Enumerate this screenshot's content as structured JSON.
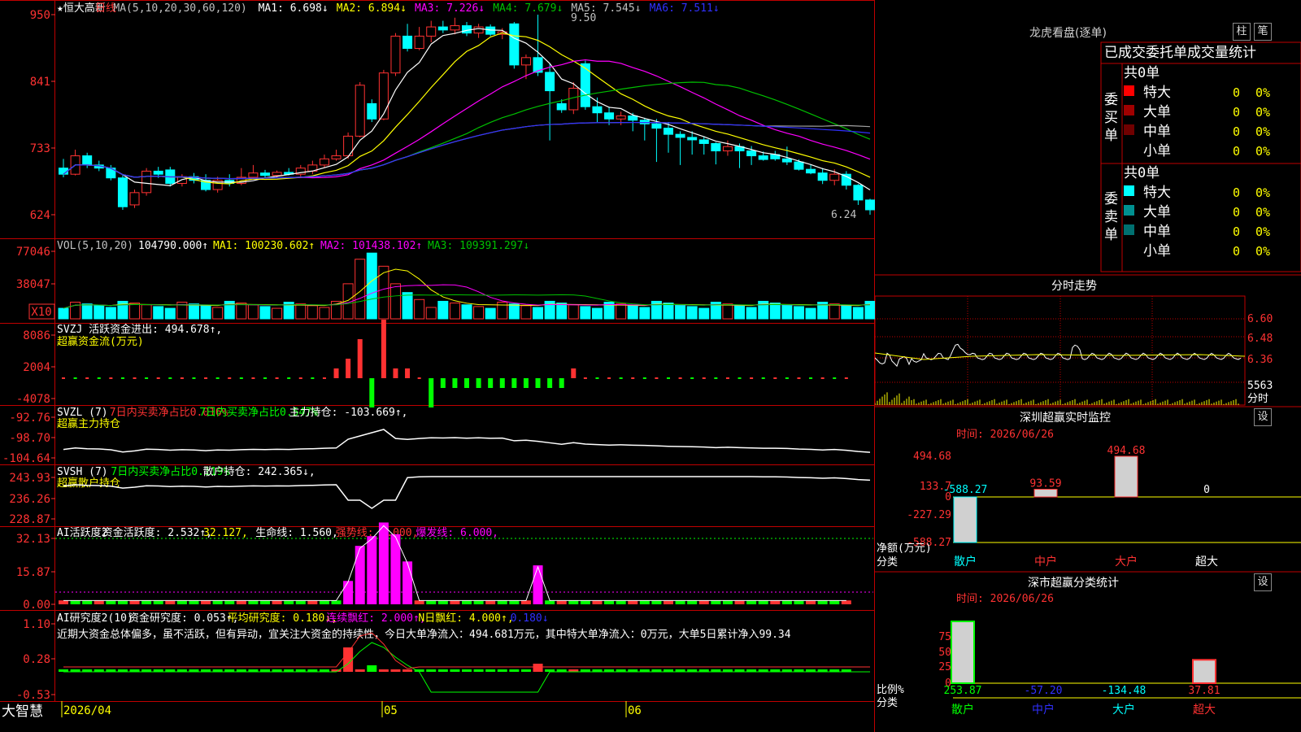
{
  "colors": {
    "up": "#ff3232",
    "down": "#00ffff",
    "grid": "#c00000",
    "ma1": "#ffffff",
    "ma2": "#ffff00",
    "ma3": "#ff00ff",
    "ma4": "#00c000",
    "ma5": "#a0a0a0",
    "ma6": "#3030ff",
    "green": "#00ff00",
    "magenta": "#ff00ff"
  },
  "stock": {
    "star": "★",
    "name": "恒大高新",
    "period": "日线"
  },
  "price_header": {
    "ma_params": "MA(5,10,20,30,60,120)",
    "ma1": "MA1: 6.698↓",
    "ma2": "MA2: 6.894↓",
    "ma3": "MA3: 7.226↓",
    "ma4": "MA4: 7.679↓",
    "ma5": "MA5: 7.545↓",
    "ma6": "MA6: 7.511↓",
    "high_note": "9.50",
    "low_note": "6.24"
  },
  "price_axis": [
    "950",
    "841",
    "733",
    "624"
  ],
  "vol_header": {
    "name": "VOL(5,10,20)",
    "value": "104790.000↑",
    "ma1": "MA1: 100230.602↑",
    "ma2": "MA2: 101438.102↑",
    "ma3": "MA3: 109391.297↓"
  },
  "vol_axis": [
    "77046",
    "38047",
    "X10"
  ],
  "svzj": {
    "line1": "SVZJ  活跃资金进出: 494.678↑,",
    "line2": "超赢资金流(万元)",
    "axis": [
      "8086",
      "2004",
      "-4078"
    ]
  },
  "svzl": {
    "t1": "SVZL (7)",
    "t2": "7日内买卖净占比0.016%",
    "t3": "7日内买卖净占比0.547%",
    "t4": "主力持仓: -103.669↑,",
    "line2": "超赢主力持仓",
    "axis": [
      "-92.76",
      "-98.70",
      "-104.64"
    ]
  },
  "svsh": {
    "t1": "SVSH (7)",
    "t2": "7日内买卖净占比0.119%",
    "t3": "散户持仓: 242.365↓,",
    "line2": "超赢散户持仓",
    "axis": [
      "243.93",
      "236.26",
      "228.87"
    ]
  },
  "ai1": {
    "t1": "AI活跃度2",
    "t2": "资金活跃度: 2.532↑,",
    "t3": "32.127,",
    "t4": "生命线: 1.560,",
    "t5": "强势线: 3.000,",
    "t6": "爆发线: 6.000,",
    "axis": [
      "32.13",
      "15.87",
      "0.00"
    ]
  },
  "ai2": {
    "t1": "AI研究度2(10)",
    "t2": "资金研究度: 0.053↑,",
    "t3": "平均研究度: 0.180↓,",
    "t4": "连续飘红: 2.000↑,",
    "t5": "N日飘红: 4.000↑,",
    "t6": "0.180↓",
    "axis": [
      "1.10",
      "0.28",
      "-0.53"
    ],
    "note": "近期大资金总体偏多，虽不活跃，但有异动，宜关注大资金的持续性，今日大单净流入：494.681万元，其中特大单净流入：0万元，大单5日累计净入99.34"
  },
  "bottom": {
    "brand": "大智慧",
    "date": "2026/04",
    "m05": "05",
    "m06": "06"
  },
  "lhkp": {
    "title": "龙虎看盘(逐单)",
    "btn1": "柱",
    "btn2": "笔",
    "subtitle": "已成交委托单成交量统计",
    "buy_label": "委买单",
    "sell_label": "委卖单",
    "buy": {
      "total": "共0单",
      "rows": [
        {
          "name": "特大",
          "v": "0",
          "p": "0%",
          "c": "#ff0000"
        },
        {
          "name": "大单",
          "v": "0",
          "p": "0%",
          "c": "#a00000"
        },
        {
          "name": "中单",
          "v": "0",
          "p": "0%",
          "c": "#700000"
        },
        {
          "name": "小单",
          "v": "0",
          "p": "0%",
          "c": ""
        }
      ]
    },
    "sell": {
      "total": "共0单",
      "rows": [
        {
          "name": "特大",
          "v": "0",
          "p": "0%",
          "c": "#00ffff"
        },
        {
          "name": "大单",
          "v": "0",
          "p": "0%",
          "c": "#009090"
        },
        {
          "name": "中单",
          "v": "0",
          "p": "0%",
          "c": "#007070"
        },
        {
          "name": "小单",
          "v": "0",
          "p": "0%",
          "c": ""
        }
      ]
    }
  },
  "fenshi": {
    "title": "分时走势",
    "axis": [
      "6.60",
      "6.48",
      "6.36"
    ],
    "vol_label": "5563",
    "unit": "分时"
  },
  "sz_monitor": {
    "title": "深圳超赢实时监控",
    "btn": "设",
    "date": "时间: 2026/06/26",
    "axis": [
      "494.68",
      "133.7",
      "0",
      "-227.29",
      "-588.27"
    ],
    "ylabel1": "净额(万元)",
    "ylabel2": "分类",
    "bars": [
      {
        "cat": "散户",
        "v": "-588.27",
        "val": -588.27
      },
      {
        "cat": "中户",
        "v": "93.59",
        "val": 93.59
      },
      {
        "cat": "大户",
        "v": "494.68",
        "val": 494.68
      },
      {
        "cat": "超大",
        "v": "0",
        "val": 0
      }
    ]
  },
  "sz_class": {
    "title": "深市超赢分类统计",
    "btn": "设",
    "date": "时间: 2026/06/26",
    "axis": [
      "75",
      "50",
      "25",
      "0"
    ],
    "ylabel1": "比例%",
    "ylabel2": "分类",
    "bars": [
      {
        "cat": "散户",
        "v": "253.87",
        "val": 100
      },
      {
        "cat": "中户",
        "v": "-57.20",
        "val": 0
      },
      {
        "cat": "大户",
        "v": "-134.48",
        "val": 0
      },
      {
        "cat": "超大",
        "v": "37.81",
        "val": 37.81
      }
    ]
  },
  "chart_data": {
    "type": "candlestick",
    "candles": [
      {
        "o": 700,
        "h": 715,
        "l": 685,
        "c": 690
      },
      {
        "o": 690,
        "h": 730,
        "l": 688,
        "c": 720
      },
      {
        "o": 720,
        "h": 725,
        "l": 700,
        "c": 705
      },
      {
        "o": 705,
        "h": 712,
        "l": 695,
        "c": 700
      },
      {
        "o": 700,
        "h": 705,
        "l": 680,
        "c": 684
      },
      {
        "o": 684,
        "h": 688,
        "l": 632,
        "c": 637
      },
      {
        "o": 640,
        "h": 665,
        "l": 635,
        "c": 660
      },
      {
        "o": 660,
        "h": 700,
        "l": 655,
        "c": 695
      },
      {
        "o": 695,
        "h": 702,
        "l": 684,
        "c": 690
      },
      {
        "o": 697,
        "h": 702,
        "l": 670,
        "c": 675
      },
      {
        "o": 675,
        "h": 690,
        "l": 670,
        "c": 686
      },
      {
        "o": 686,
        "h": 692,
        "l": 675,
        "c": 680
      },
      {
        "o": 680,
        "h": 690,
        "l": 662,
        "c": 665
      },
      {
        "o": 665,
        "h": 686,
        "l": 660,
        "c": 680
      },
      {
        "o": 680,
        "h": 690,
        "l": 670,
        "c": 675
      },
      {
        "o": 675,
        "h": 700,
        "l": 672,
        "c": 685
      },
      {
        "o": 685,
        "h": 705,
        "l": 682,
        "c": 692
      },
      {
        "o": 692,
        "h": 697,
        "l": 685,
        "c": 688
      },
      {
        "o": 688,
        "h": 696,
        "l": 684,
        "c": 693
      },
      {
        "o": 693,
        "h": 700,
        "l": 688,
        "c": 690
      },
      {
        "o": 690,
        "h": 705,
        "l": 686,
        "c": 700
      },
      {
        "o": 695,
        "h": 712,
        "l": 690,
        "c": 705
      },
      {
        "o": 705,
        "h": 722,
        "l": 700,
        "c": 715
      },
      {
        "o": 715,
        "h": 730,
        "l": 712,
        "c": 720
      },
      {
        "o": 720,
        "h": 758,
        "l": 715,
        "c": 752
      },
      {
        "o": 752,
        "h": 840,
        "l": 750,
        "c": 835
      },
      {
        "o": 805,
        "h": 812,
        "l": 775,
        "c": 780
      },
      {
        "o": 780,
        "h": 860,
        "l": 778,
        "c": 855
      },
      {
        "o": 855,
        "h": 920,
        "l": 850,
        "c": 915
      },
      {
        "o": 915,
        "h": 935,
        "l": 890,
        "c": 895
      },
      {
        "o": 895,
        "h": 930,
        "l": 892,
        "c": 915
      },
      {
        "o": 915,
        "h": 940,
        "l": 905,
        "c": 930
      },
      {
        "o": 930,
        "h": 940,
        "l": 920,
        "c": 925
      },
      {
        "o": 925,
        "h": 945,
        "l": 918,
        "c": 932
      },
      {
        "o": 932,
        "h": 938,
        "l": 915,
        "c": 920
      },
      {
        "o": 920,
        "h": 935,
        "l": 912,
        "c": 930
      },
      {
        "o": 930,
        "h": 934,
        "l": 915,
        "c": 918
      },
      {
        "o": 918,
        "h": 928,
        "l": 910,
        "c": 922
      },
      {
        "o": 935,
        "h": 938,
        "l": 862,
        "c": 868
      },
      {
        "o": 868,
        "h": 885,
        "l": 845,
        "c": 880
      },
      {
        "o": 880,
        "h": 950,
        "l": 850,
        "c": 856
      },
      {
        "o": 856,
        "h": 870,
        "l": 745,
        "c": 826
      },
      {
        "o": 805,
        "h": 812,
        "l": 790,
        "c": 795
      },
      {
        "o": 795,
        "h": 840,
        "l": 788,
        "c": 830
      },
      {
        "o": 870,
        "h": 875,
        "l": 795,
        "c": 800
      },
      {
        "o": 800,
        "h": 815,
        "l": 775,
        "c": 790
      },
      {
        "o": 790,
        "h": 800,
        "l": 770,
        "c": 780
      },
      {
        "o": 780,
        "h": 792,
        "l": 770,
        "c": 785
      },
      {
        "o": 785,
        "h": 790,
        "l": 760,
        "c": 778
      },
      {
        "o": 778,
        "h": 782,
        "l": 745,
        "c": 772
      },
      {
        "o": 772,
        "h": 780,
        "l": 710,
        "c": 765
      },
      {
        "o": 765,
        "h": 775,
        "l": 725,
        "c": 755
      },
      {
        "o": 755,
        "h": 760,
        "l": 705,
        "c": 750
      },
      {
        "o": 750,
        "h": 760,
        "l": 722,
        "c": 746
      },
      {
        "o": 746,
        "h": 752,
        "l": 722,
        "c": 740
      },
      {
        "o": 740,
        "h": 742,
        "l": 706,
        "c": 728
      },
      {
        "o": 728,
        "h": 745,
        "l": 720,
        "c": 735
      },
      {
        "o": 735,
        "h": 740,
        "l": 700,
        "c": 728
      },
      {
        "o": 728,
        "h": 736,
        "l": 705,
        "c": 720
      },
      {
        "o": 720,
        "h": 727,
        "l": 712,
        "c": 714
      },
      {
        "o": 722,
        "h": 728,
        "l": 712,
        "c": 715
      },
      {
        "o": 715,
        "h": 735,
        "l": 705,
        "c": 710
      },
      {
        "o": 710,
        "h": 714,
        "l": 696,
        "c": 698
      },
      {
        "o": 698,
        "h": 705,
        "l": 690,
        "c": 692
      },
      {
        "o": 692,
        "h": 700,
        "l": 674,
        "c": 680
      },
      {
        "o": 680,
        "h": 698,
        "l": 672,
        "c": 690
      },
      {
        "o": 690,
        "h": 695,
        "l": 665,
        "c": 672
      },
      {
        "o": 672,
        "h": 674,
        "l": 640,
        "c": 648
      },
      {
        "o": 648,
        "h": 650,
        "l": 624,
        "c": 632
      }
    ],
    "price_range": [
      600,
      950
    ],
    "x_labels": [
      "2026/04",
      "05",
      "06"
    ]
  }
}
